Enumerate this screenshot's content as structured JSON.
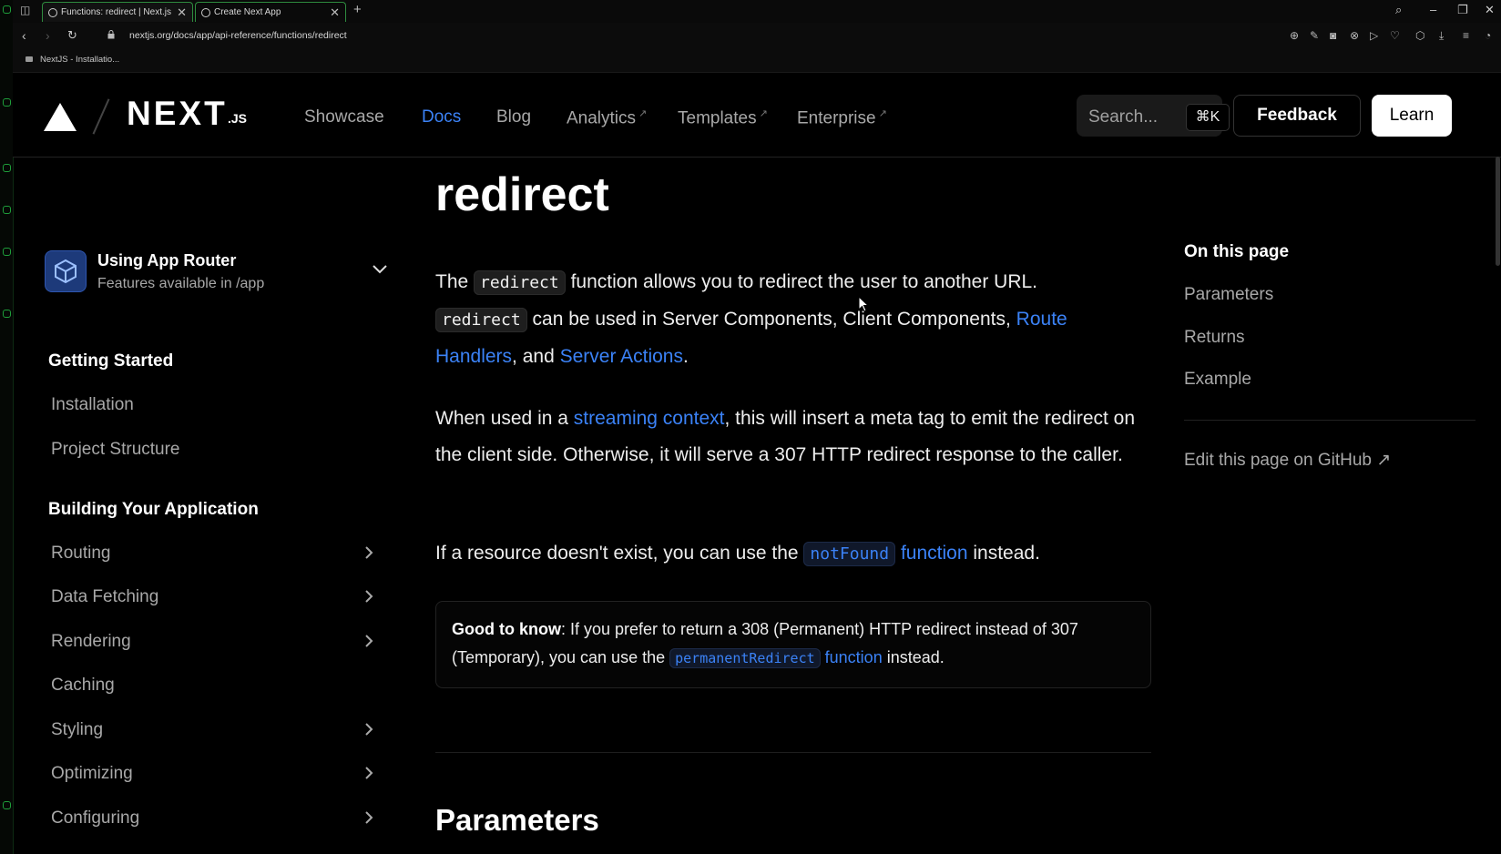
{
  "browser": {
    "tabs": [
      {
        "title": "Functions: redirect | Next.js",
        "active": true
      },
      {
        "title": "Create Next App",
        "active": false
      }
    ],
    "new_tab": "+",
    "url": "nextjs.org/docs/app/api-reference/functions/redirect",
    "bookmark": "NextJS - Installatio..."
  },
  "header": {
    "logo_text": "NEXT",
    "logo_suffix": ".JS",
    "nav": [
      {
        "label": "Showcase",
        "active": false,
        "external": false
      },
      {
        "label": "Docs",
        "active": true,
        "external": false
      },
      {
        "label": "Blog",
        "active": false,
        "external": false
      },
      {
        "label": "Analytics",
        "active": false,
        "external": true
      },
      {
        "label": "Templates",
        "active": false,
        "external": true
      },
      {
        "label": "Enterprise",
        "active": false,
        "external": true
      }
    ],
    "external_mark": "↗",
    "search_placeholder": "Search...",
    "search_shortcut": "⌘K",
    "feedback_label": "Feedback",
    "learn_label": "Learn"
  },
  "sidebar": {
    "router_title": "Using App Router",
    "router_subtitle": "Features available in /app",
    "section1": "Getting Started",
    "section1_items": [
      "Installation",
      "Project Structure"
    ],
    "section2": "Building Your Application",
    "section2_items": [
      {
        "label": "Routing",
        "expandable": true
      },
      {
        "label": "Data Fetching",
        "expandable": true
      },
      {
        "label": "Rendering",
        "expandable": true
      },
      {
        "label": "Caching",
        "expandable": false
      },
      {
        "label": "Styling",
        "expandable": true
      },
      {
        "label": "Optimizing",
        "expandable": true
      },
      {
        "label": "Configuring",
        "expandable": true
      }
    ]
  },
  "main": {
    "title": "redirect",
    "p1": {
      "t1": "The ",
      "code1": "redirect",
      "t2": " function allows you to redirect the user to another URL.",
      "code2": "redirect",
      "t3": " can be used in Server Components, Client Components, ",
      "link1": "Route Handlers",
      "t4": ", and ",
      "link2": "Server Actions",
      "t5": "."
    },
    "p2": {
      "t1": "When used in a ",
      "link1": "streaming context",
      "t2": ", this will insert a meta tag to emit the redirect on the client side. Otherwise, it will serve a 307 HTTP redirect response to the caller."
    },
    "p3": {
      "t1": "If a resource doesn't exist, you can use the ",
      "code1": "notFound",
      "link1": "function",
      "t2": " instead."
    },
    "note": {
      "bold": "Good to know",
      "t1": ": If you prefer to return a 308 (Permanent) HTTP redirect instead of 307 (Temporary), you can use the ",
      "code1": "permanentRedirect",
      "link1": "function",
      "t2": " instead."
    },
    "params_heading": "Parameters"
  },
  "toc": {
    "title": "On this page",
    "links": [
      "Parameters",
      "Returns",
      "Example"
    ],
    "edit_github": "Edit this page on GitHub"
  },
  "colors": {
    "accent": "#3b82f6",
    "background": "#000000",
    "chrome_green": "#2e8b3e"
  }
}
